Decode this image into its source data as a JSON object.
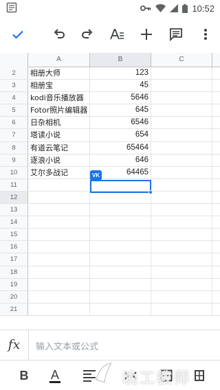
{
  "status_bar": {
    "time": "10:52"
  },
  "toolbar": {
    "icons": [
      "check-icon",
      "undo-icon",
      "redo-icon",
      "text-format-icon",
      "add-icon",
      "comment-icon",
      "more-icon"
    ]
  },
  "grid": {
    "columns": [
      "A",
      "B",
      "C"
    ],
    "selected_column": "B",
    "selected_row": "12",
    "rows": [
      {
        "num": "2",
        "a": "相册大师",
        "b": "123"
      },
      {
        "num": "3",
        "a": "相册宝",
        "b": "45"
      },
      {
        "num": "4",
        "a": "kodi音乐播放器",
        "b": "5646"
      },
      {
        "num": "5",
        "a": "Fotor照片编辑器",
        "b": "645"
      },
      {
        "num": "6",
        "a": "日杂相机",
        "b": "6546"
      },
      {
        "num": "7",
        "a": "塔读小说",
        "b": "654"
      },
      {
        "num": "8",
        "a": "有道云笔记",
        "b": "65464"
      },
      {
        "num": "9",
        "a": "逐浪小说",
        "b": "646"
      },
      {
        "num": "10",
        "a": "艾尔多战记",
        "b": "64465"
      },
      {
        "num": "11",
        "a": "",
        "b": ""
      },
      {
        "num": "12",
        "a": "",
        "b": ""
      },
      {
        "num": "13",
        "a": "",
        "b": ""
      },
      {
        "num": "14",
        "a": "",
        "b": ""
      },
      {
        "num": "15",
        "a": "",
        "b": ""
      },
      {
        "num": "16",
        "a": "",
        "b": ""
      },
      {
        "num": "17",
        "a": "",
        "b": ""
      },
      {
        "num": "18",
        "a": "",
        "b": ""
      },
      {
        "num": "19",
        "a": "",
        "b": ""
      },
      {
        "num": "20",
        "a": "",
        "b": ""
      },
      {
        "num": "21",
        "a": "",
        "b": ""
      }
    ],
    "cell_chip": "VK"
  },
  "formula_bar": {
    "fx_label": "fx",
    "placeholder": "输入文本或公式"
  },
  "format_bar": {
    "bold": "B",
    "text_color": "A"
  },
  "watermark": {
    "text": "晚工教师"
  },
  "colors": {
    "accent": "#1a73e8",
    "header_bg": "#f8f9fa",
    "selected_header_bg": "#e8eaed"
  }
}
